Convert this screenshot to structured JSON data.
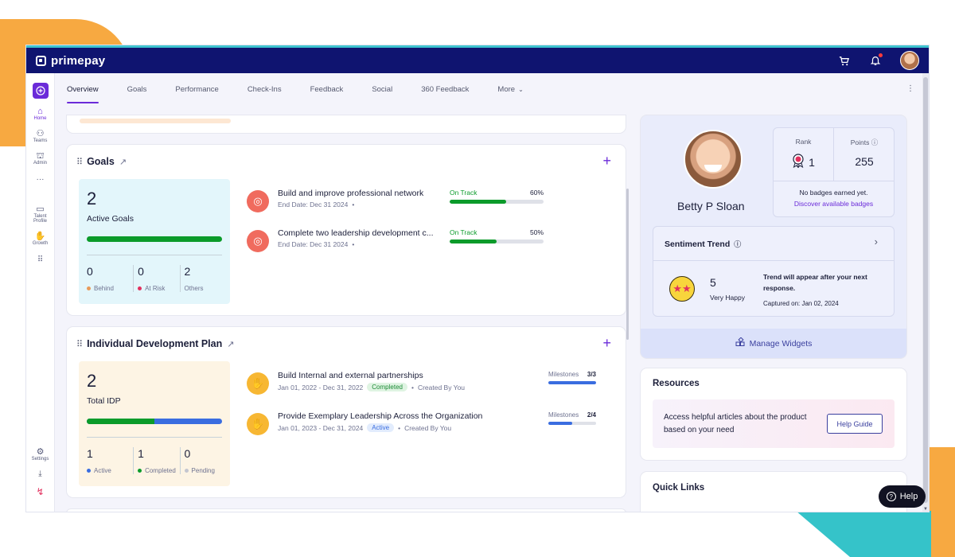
{
  "brand": {
    "name": "primepay"
  },
  "colors": {
    "accent": "#6b2bd9",
    "navy": "#0f1470",
    "green": "#0b9b2a",
    "blue": "#3a6de0",
    "red": "#e2305e",
    "orange": "#f06b5e"
  },
  "topbar": {
    "icons": [
      "cart-icon",
      "bell-icon",
      "avatar"
    ]
  },
  "sidebar": {
    "items": [
      {
        "label": "Home",
        "icon": "home-icon"
      },
      {
        "label": "Teams",
        "icon": "team-icon"
      },
      {
        "label": "Admin",
        "icon": "admin-icon"
      },
      {
        "label": "Talent Profile",
        "icon": "profile-card-icon"
      },
      {
        "label": "Growth",
        "icon": "growth-icon"
      }
    ],
    "settings_label": "Settings"
  },
  "tabs": [
    "Overview",
    "Goals",
    "Performance",
    "Check-Ins",
    "Feedback",
    "Social",
    "360 Feedback",
    "More"
  ],
  "goals": {
    "title": "Goals",
    "summary": {
      "count": "2",
      "label": "Active Goals",
      "progress": 1.0
    },
    "stats": [
      {
        "value": "0",
        "label": "Behind",
        "color": "#e89a5a"
      },
      {
        "value": "0",
        "label": "At Risk",
        "color": "#e2305e"
      },
      {
        "value": "2",
        "label": "Others",
        "color": ""
      }
    ],
    "items": [
      {
        "title": "Build and improve professional network",
        "end_date": "End Date: Dec 31 2024",
        "status": "On Track",
        "percent_label": "60%",
        "percent": 60
      },
      {
        "title": "Complete two leadership development c...",
        "end_date": "End Date: Dec 31 2024",
        "status": "On Track",
        "percent_label": "50%",
        "percent": 50
      }
    ]
  },
  "idp": {
    "title": "Individual Development Plan",
    "summary": {
      "count": "2",
      "label": "Total IDP",
      "completed_fraction": 0.5
    },
    "stats": [
      {
        "value": "1",
        "label": "Active",
        "color": "#3a6de0"
      },
      {
        "value": "1",
        "label": "Completed",
        "color": "#0b9b2a"
      },
      {
        "value": "0",
        "label": "Pending",
        "color": "#c4c6d0"
      }
    ],
    "items": [
      {
        "title": "Build Internal and external partnerships",
        "dates": "Jan 01, 2022 - Dec 31, 2022",
        "status": "Completed",
        "created": "Created By You",
        "milestones_label": "Milestones",
        "milestones": "3/3",
        "fraction": 1.0
      },
      {
        "title": "Provide Exemplary Leadership Across the Organization",
        "dates": "Jan 01, 2023 - Dec 31, 2024",
        "status": "Active",
        "created": "Created By You",
        "milestones_label": "Milestones",
        "milestones": "2/4",
        "fraction": 0.5
      }
    ]
  },
  "profile": {
    "name": "Betty P Sloan",
    "rank_label": "Rank",
    "rank": "1",
    "points_label": "Points",
    "points": "255",
    "badges_text": "No badges earned yet.",
    "badges_link": "Discover available badges"
  },
  "sentiment": {
    "title": "Sentiment Trend",
    "score": "5",
    "mood": "Very Happy",
    "note": "Trend will appear after your next response.",
    "captured": "Captured on: Jan 02, 2024"
  },
  "manage_widgets": "Manage Widgets",
  "resources": {
    "title": "Resources",
    "text": "Access helpful articles about the product based on your need",
    "button": "Help Guide"
  },
  "quick_links": {
    "title": "Quick Links"
  },
  "help": {
    "label": "Help"
  }
}
